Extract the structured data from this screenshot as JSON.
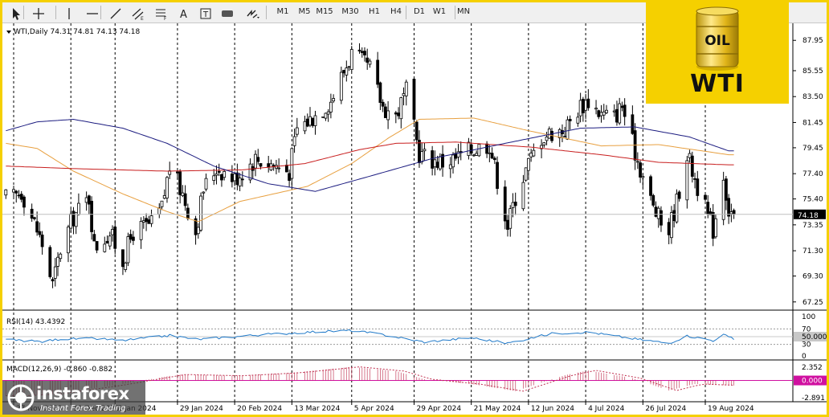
{
  "toolbar": {
    "tools": [
      {
        "name": "cursor-tool",
        "icon": "arrow-cursor-icon"
      },
      {
        "name": "crosshair-tool",
        "icon": "crosshair-icon"
      },
      {
        "name": "vertical-line-tool",
        "icon": "vertical-line-icon"
      },
      {
        "name": "horizontal-line-tool",
        "icon": "horizontal-line-icon"
      },
      {
        "name": "trendline-tool",
        "icon": "trendline-icon"
      },
      {
        "name": "equidistant-channel-tool",
        "icon": "channel-icon"
      },
      {
        "name": "fibonacci-tool",
        "icon": "fibonacci-icon"
      },
      {
        "name": "text-tool",
        "icon": "text-icon",
        "label": "A"
      },
      {
        "name": "text-label-tool",
        "icon": "text-label-icon"
      },
      {
        "name": "rectangle-tool",
        "icon": "rectangle-icon"
      },
      {
        "name": "arrows-tool",
        "icon": "arrows-icon"
      }
    ],
    "timeframes": [
      "M1",
      "M5",
      "M15",
      "M30",
      "H1",
      "H4",
      "D1",
      "W1",
      "MN"
    ]
  },
  "logo": {
    "text": "WTI",
    "barrel_text": "OIL"
  },
  "watermark": {
    "brand": "instaforex",
    "tagline": "Instant Forex Trading"
  },
  "colors": {
    "frame": "#f5d000",
    "candle": "#000000",
    "grid": "#000000",
    "ma_orange": "#e8a040",
    "ma_red": "#c81e1e",
    "ma_navy": "#1c1c80",
    "rsi": "#1e78c8",
    "macd_hist": "#c03050",
    "macd_signal": "#c03050",
    "macd_zero": "#d010a0"
  },
  "chart_data": [
    {
      "type": "candlestick",
      "title": "WTI,Daily",
      "ohlc_header": "74.31 74.81 74.13 74.18",
      "last_price": 74.18,
      "y_ticks": [
        "87.95",
        "85.55",
        "83.50",
        "81.45",
        "79.45",
        "77.40",
        "75.40",
        "73.35",
        "71.30",
        "69.30",
        "67.25"
      ],
      "ylim": [
        66.6,
        89.3
      ],
      "date_labels": [
        "27 Nov 2023",
        "19 Dec 2023",
        "5 Jan 2024",
        "29 Jan 2024",
        "20 Feb 2024",
        "13 Mar 2024",
        "5 Apr 2024",
        "29 Apr 2024",
        "21 May 2024",
        "12 Jun 2024",
        "4 Jul 2024",
        "26 Jul 2024",
        "19 Aug 2024"
      ],
      "anchors": [
        [
          "2023-11-27",
          75.5
        ],
        [
          "2023-11-30",
          76.0
        ],
        [
          "2023-12-05",
          73.5
        ],
        [
          "2023-12-08",
          71.8
        ],
        [
          "2023-12-12",
          68.6
        ],
        [
          "2023-12-15",
          71.4
        ],
        [
          "2023-12-20",
          74.0
        ],
        [
          "2023-12-26",
          75.5
        ],
        [
          "2023-12-28",
          71.6
        ],
        [
          "2024-01-03",
          72.7
        ],
        [
          "2024-01-08",
          70.5
        ],
        [
          "2024-01-12",
          72.8
        ],
        [
          "2024-01-19",
          73.4
        ],
        [
          "2024-01-23",
          74.7
        ],
        [
          "2024-01-26",
          78.0
        ],
        [
          "2024-01-31",
          75.8
        ],
        [
          "2024-02-05",
          72.8
        ],
        [
          "2024-02-08",
          76.2
        ],
        [
          "2024-02-13",
          77.9
        ],
        [
          "2024-02-20",
          77.0
        ],
        [
          "2024-02-28",
          78.6
        ],
        [
          "2024-03-05",
          78.2
        ],
        [
          "2024-03-12",
          77.6
        ],
        [
          "2024-03-15",
          81.0
        ],
        [
          "2024-03-20",
          81.7
        ],
        [
          "2024-03-28",
          83.2
        ],
        [
          "2024-04-05",
          86.9
        ],
        [
          "2024-04-12",
          85.7
        ],
        [
          "2024-04-17",
          82.7
        ],
        [
          "2024-04-22",
          82.0
        ],
        [
          "2024-04-26",
          83.9
        ],
        [
          "2024-05-01",
          79.0
        ],
        [
          "2024-05-06",
          78.5
        ],
        [
          "2024-05-10",
          78.3
        ],
        [
          "2024-05-15",
          78.6
        ],
        [
          "2024-05-21",
          79.3
        ],
        [
          "2024-05-28",
          79.8
        ],
        [
          "2024-05-31",
          77.0
        ],
        [
          "2024-06-04",
          73.3
        ],
        [
          "2024-06-07",
          75.6
        ],
        [
          "2024-06-12",
          78.2
        ],
        [
          "2024-06-17",
          80.3
        ],
        [
          "2024-06-21",
          80.7
        ],
        [
          "2024-06-26",
          80.9
        ],
        [
          "2024-07-02",
          82.8
        ],
        [
          "2024-07-05",
          83.2
        ],
        [
          "2024-07-10",
          82.1
        ],
        [
          "2024-07-15",
          81.9
        ],
        [
          "2024-07-18",
          82.8
        ],
        [
          "2024-07-22",
          79.8
        ],
        [
          "2024-07-26",
          77.2
        ],
        [
          "2024-07-30",
          74.7
        ],
        [
          "2024-08-02",
          73.5
        ],
        [
          "2024-08-05",
          73.0
        ],
        [
          "2024-08-08",
          75.2
        ],
        [
          "2024-08-12",
          79.0
        ],
        [
          "2024-08-15",
          77.0
        ],
        [
          "2024-08-20",
          74.0
        ],
        [
          "2024-08-22",
          73.0
        ],
        [
          "2024-08-26",
          77.4
        ],
        [
          "2024-08-28",
          74.5
        ],
        [
          "2024-08-30",
          74.2
        ]
      ],
      "moving_averages": [
        {
          "color": "ma_orange",
          "anchors": [
            [
              "2023-11-24",
              79.8
            ],
            [
              "2023-12-06",
              79.4
            ],
            [
              "2023-12-20",
              77.6
            ],
            [
              "2024-01-08",
              75.8
            ],
            [
              "2024-01-25",
              74.4
            ],
            [
              "2024-02-06",
              73.6
            ],
            [
              "2024-02-22",
              75.2
            ],
            [
              "2024-03-19",
              76.4
            ],
            [
              "2024-04-05",
              78.2
            ],
            [
              "2024-04-19",
              80.2
            ],
            [
              "2024-05-01",
              81.7
            ],
            [
              "2024-05-22",
              81.8
            ],
            [
              "2024-06-12",
              80.8
            ],
            [
              "2024-07-10",
              79.6
            ],
            [
              "2024-08-01",
              79.7
            ],
            [
              "2024-08-28",
              78.9
            ]
          ]
        },
        {
          "color": "ma_red",
          "anchors": [
            [
              "2023-11-24",
              78.0
            ],
            [
              "2023-12-20",
              77.8
            ],
            [
              "2024-01-25",
              77.6
            ],
            [
              "2024-02-23",
              77.7
            ],
            [
              "2024-03-18",
              78.2
            ],
            [
              "2024-04-08",
              79.3
            ],
            [
              "2024-04-22",
              79.8
            ],
            [
              "2024-05-15",
              79.9
            ],
            [
              "2024-06-13",
              79.5
            ],
            [
              "2024-07-10",
              78.9
            ],
            [
              "2024-08-01",
              78.3
            ],
            [
              "2024-08-28",
              78.1
            ]
          ]
        },
        {
          "color": "ma_navy",
          "anchors": [
            [
              "2023-11-24",
              80.8
            ],
            [
              "2023-12-06",
              81.5
            ],
            [
              "2023-12-20",
              81.7
            ],
            [
              "2024-01-08",
              81.0
            ],
            [
              "2024-01-25",
              79.8
            ],
            [
              "2024-02-12",
              78.0
            ],
            [
              "2024-03-04",
              76.6
            ],
            [
              "2024-03-22",
              76.0
            ],
            [
              "2024-04-12",
              77.2
            ],
            [
              "2024-05-06",
              78.6
            ],
            [
              "2024-06-03",
              79.8
            ],
            [
              "2024-07-02",
              81.0
            ],
            [
              "2024-07-23",
              81.1
            ],
            [
              "2024-08-13",
              80.3
            ],
            [
              "2024-08-28",
              79.2
            ]
          ]
        }
      ],
      "vertical_separator_dates": [
        "2023-11-27",
        "2023-12-19",
        "2024-01-05",
        "2024-01-29",
        "2024-02-20",
        "2024-03-13",
        "2024-04-05",
        "2024-04-29",
        "2024-05-21",
        "2024-06-12",
        "2024-07-04",
        "2024-07-26",
        "2024-08-19"
      ]
    },
    {
      "type": "line",
      "title": "RSI(14) 43.4392",
      "levels": [
        "70",
        "50.0000",
        "30"
      ],
      "y_ticks": [
        "100",
        "0"
      ],
      "ylim": [
        0,
        100
      ],
      "anchors": [
        [
          "2023-11-27",
          41
        ],
        [
          "2023-12-08",
          37
        ],
        [
          "2023-12-15",
          44
        ],
        [
          "2023-12-28",
          45
        ],
        [
          "2024-01-08",
          40
        ],
        [
          "2024-01-26",
          53
        ],
        [
          "2024-02-06",
          43
        ],
        [
          "2024-02-28",
          54
        ],
        [
          "2024-03-20",
          62
        ],
        [
          "2024-04-05",
          66
        ],
        [
          "2024-04-17",
          55
        ],
        [
          "2024-05-03",
          36
        ],
        [
          "2024-05-21",
          47
        ],
        [
          "2024-06-04",
          33
        ],
        [
          "2024-06-21",
          58
        ],
        [
          "2024-07-05",
          62
        ],
        [
          "2024-07-22",
          45
        ],
        [
          "2024-08-05",
          33
        ],
        [
          "2024-08-12",
          52
        ],
        [
          "2024-08-22",
          40
        ],
        [
          "2024-08-26",
          55
        ],
        [
          "2024-08-30",
          43
        ]
      ]
    },
    {
      "type": "bar",
      "title": "MACD(12,26,9) -0.860 -0.882",
      "y_ticks": [
        "2.352",
        "0.000",
        "-2.891"
      ],
      "ylim": [
        -3.6,
        3.2
      ],
      "zero_line": "0.000",
      "anchors": [
        [
          "2023-11-27",
          -2.6
        ],
        [
          "2023-12-12",
          -2.3
        ],
        [
          "2024-01-05",
          -0.8
        ],
        [
          "2024-01-29",
          1.0
        ],
        [
          "2024-02-20",
          0.8
        ],
        [
          "2024-03-13",
          1.3
        ],
        [
          "2024-04-05",
          2.3
        ],
        [
          "2024-04-22",
          1.6
        ],
        [
          "2024-05-03",
          0.2
        ],
        [
          "2024-05-21",
          -0.6
        ],
        [
          "2024-06-07",
          -1.8
        ],
        [
          "2024-06-26",
          0.9
        ],
        [
          "2024-07-05",
          1.7
        ],
        [
          "2024-07-22",
          0.4
        ],
        [
          "2024-08-05",
          -1.7
        ],
        [
          "2024-08-15",
          -0.6
        ],
        [
          "2024-08-30",
          -0.86
        ]
      ]
    }
  ]
}
